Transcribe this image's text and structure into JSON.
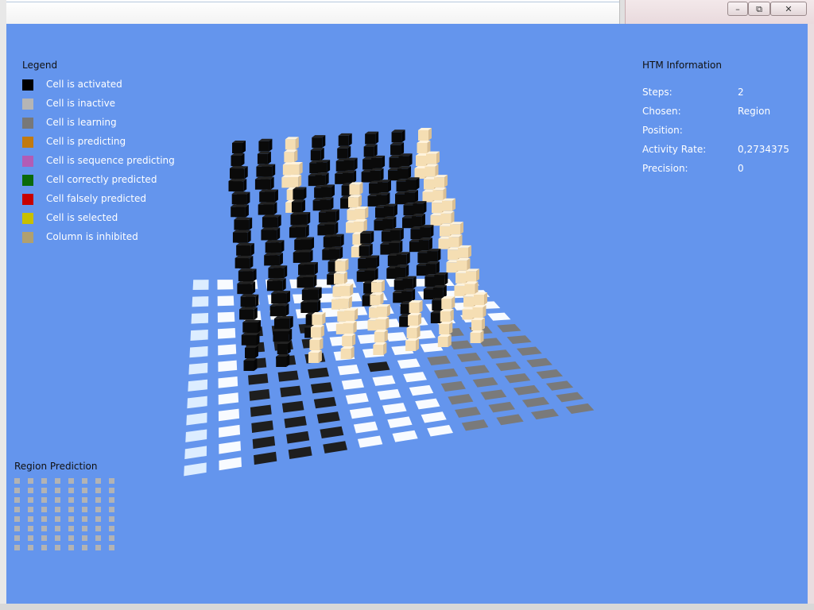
{
  "legend": {
    "title": "Legend",
    "items": [
      {
        "label": "Cell is activated",
        "color": "#000000"
      },
      {
        "label": "Cell is inactive",
        "color": "#b5b5b5"
      },
      {
        "label": "Cell is learning",
        "color": "#787878"
      },
      {
        "label": "Cell is predicting",
        "color": "#c27a10"
      },
      {
        "label": "Cell is sequence predicting",
        "color": "#b25cb5"
      },
      {
        "label": "Cell correctly predicted",
        "color": "#0a6a0a"
      },
      {
        "label": "Cell falsely predicted",
        "color": "#c80000"
      },
      {
        "label": "Cell is selected",
        "color": "#c8c000"
      },
      {
        "label": "Column is inhibited",
        "color": "#b0a070"
      }
    ]
  },
  "htm_info": {
    "title": "HTM Information",
    "rows": [
      {
        "key": "Steps:",
        "value": "2"
      },
      {
        "key": "Chosen:",
        "value": "Region"
      },
      {
        "key": "Position:",
        "value": ""
      },
      {
        "key": "Activity Rate:",
        "value": "0,2734375"
      },
      {
        "key": "Precision:",
        "value": "0"
      }
    ]
  },
  "region_prediction": {
    "title": "Region Prediction"
  },
  "colors": {
    "viewport_bg": "#6495ed",
    "cell_active": "#0a0a0a",
    "cell_inhibited": "#f5deb3",
    "plane_white": "#f8fbff",
    "plane_dark": "#1e1e1e",
    "plane_gray": "#7a7a7a"
  }
}
